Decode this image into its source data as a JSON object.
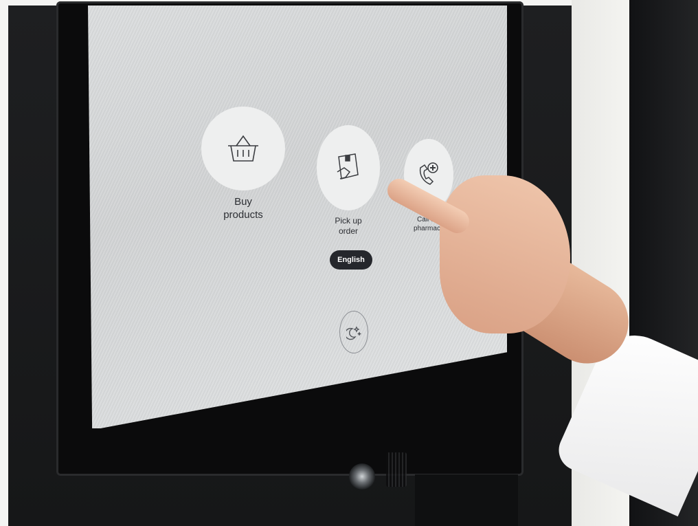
{
  "kiosk": {
    "menu": [
      {
        "label_line1": "Buy",
        "label_line2": "products",
        "icon": "basket-icon"
      },
      {
        "label_line1": "Pick up",
        "label_line2": "order",
        "icon": "package-hand-icon"
      },
      {
        "label_line1": "Call the",
        "label_line2": "pharmacy",
        "icon": "phone-plus-icon"
      }
    ],
    "language_label": "English",
    "night_mode_icon": "moon-stars-icon"
  },
  "colors": {
    "screen_bg": "#dcdedf",
    "circle_bg": "#eeefef",
    "button_dark": "#25272c",
    "text_dark": "#2c2e33"
  }
}
